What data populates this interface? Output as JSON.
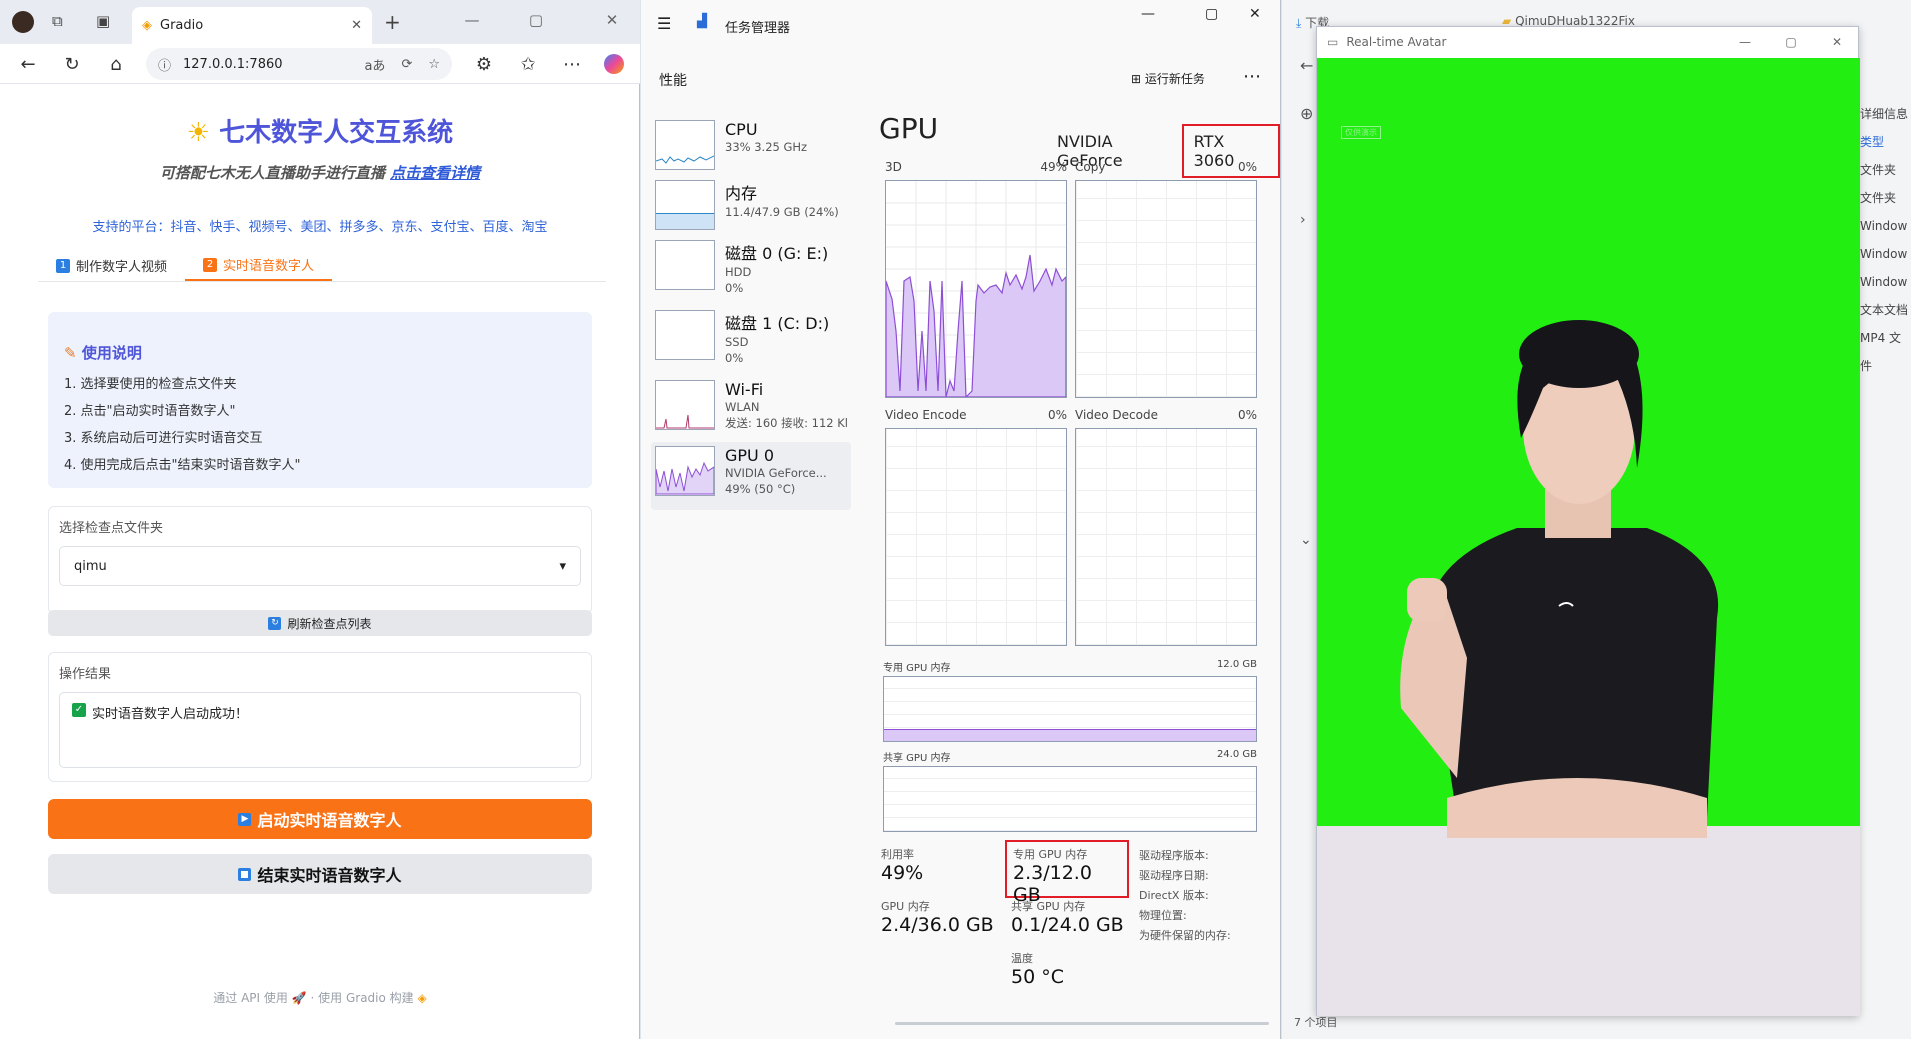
{
  "browser": {
    "tab_title": "Gradio",
    "url": "127.0.0.1:7860",
    "url_extra": "aあ",
    "page": {
      "title": "七木数字人交互系统",
      "subtitle_prefix": "可搭配七木无人直播助手进行直播",
      "subtitle_link": "点击查看详情",
      "platforms": "支持的平台：抖音、快手、视频号、美团、拼多多、京东、支付宝、百度、淘宝",
      "tabs": [
        {
          "num": "1",
          "label": "制作数字人视频"
        },
        {
          "num": "2",
          "label": "实时语音数字人"
        }
      ],
      "instructions": {
        "heading": "使用说明",
        "items": [
          "1. 选择要使用的检查点文件夹",
          "2. 点击\"启动实时语音数字人\"",
          "3. 系统启动后可进行实时语音交互",
          "4. 使用完成后点击\"结束实时语音数字人\""
        ]
      },
      "checkpoint": {
        "label": "选择检查点文件夹",
        "value": "qimu"
      },
      "refresh_label": "刷新检查点列表",
      "result": {
        "label": "操作结果",
        "text": "实时语音数字人启动成功！"
      },
      "start_label": "启动实时语音数字人",
      "stop_label": "结束实时语音数字人",
      "footer_api": "通过 API 使用",
      "footer_sep": "·",
      "footer_built": "使用 Gradio 构建"
    }
  },
  "taskmgr": {
    "title": "任务管理器",
    "section": "性能",
    "run_task": "运行新任务",
    "devices": [
      {
        "name": "CPU",
        "l1": "33% 3.25 GHz",
        "l2": ""
      },
      {
        "name": "内存",
        "l1": "11.4/47.9 GB (24%)",
        "l2": ""
      },
      {
        "name": "磁盘 0 (G: E:)",
        "l1": "HDD",
        "l2": "0%"
      },
      {
        "name": "磁盘 1 (C: D:)",
        "l1": "SSD",
        "l2": "0%"
      },
      {
        "name": "Wi-Fi",
        "l1": "WLAN",
        "l2": "发送: 160 接收: 112 Kl"
      },
      {
        "name": "GPU 0",
        "l1": "NVIDIA GeForce...",
        "l2": "49% (50 °C)"
      }
    ],
    "gpu": {
      "title": "GPU",
      "name_prefix": "NVIDIA GeForce",
      "name_model": "RTX 3060",
      "graphs": [
        {
          "name": "3D",
          "pct": "49%"
        },
        {
          "name": "Copy",
          "pct": "0%"
        },
        {
          "name": "Video Encode",
          "pct": "0%"
        },
        {
          "name": "Video Decode",
          "pct": "0%"
        }
      ],
      "dedicated_label": "专用 GPU 内存",
      "dedicated_max": "12.0 GB",
      "shared_label": "共享 GPU 内存",
      "shared_max": "24.0 GB",
      "stats": {
        "util_label": "利用率",
        "util_value": "49%",
        "ded_label": "专用 GPU 内存",
        "ded_value": "2.3/12.0 GB",
        "gpumem_label": "GPU 内存",
        "gpumem_value": "2.4/36.0 GB",
        "shared_label": "共享 GPU 内存",
        "shared_value": "0.1/24.0 GB",
        "temp_label": "温度",
        "temp_value": "50 °C"
      },
      "info_labels": [
        "驱动程序版本:",
        "驱动程序日期:",
        "DirectX 版本:",
        "物理位置:",
        "为硬件保留的内存:"
      ]
    }
  },
  "explorer": {
    "tab1": "下载",
    "tab2": "QimuDHuab1322Fix",
    "side_items": [
      "详细信息",
      "类型",
      "文件夹",
      "文件夹",
      "Window",
      "Window",
      "Window",
      "文本文档",
      "MP4 文件"
    ],
    "status": "7 个项目"
  },
  "avatar": {
    "window_title": "Real-time Avatar",
    "overlay_text": "仅供演示"
  },
  "colors": {
    "accent_orange": "#f97316",
    "title_purple": "#4e55d8",
    "chroma_green": "#22ee11",
    "gpu_purple": "#8c4fd6",
    "highlight_red": "#e11d28"
  }
}
